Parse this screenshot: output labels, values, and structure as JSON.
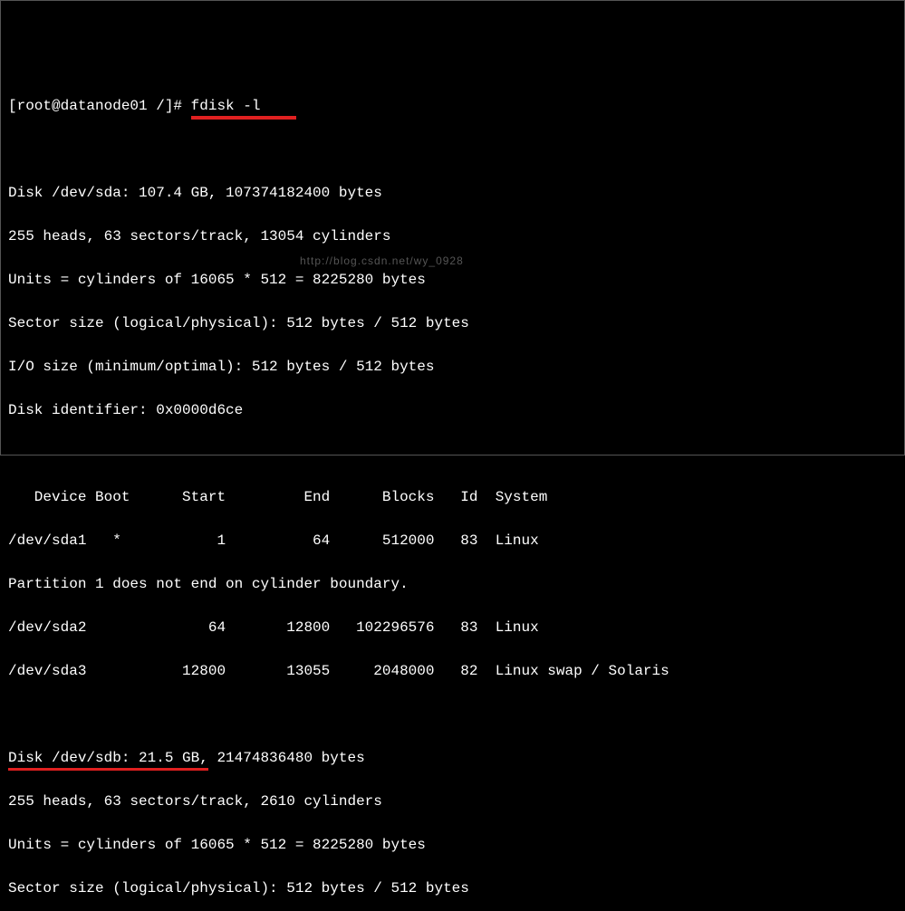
{
  "prompt": {
    "user_host_path": "[root@datanode01 /]# ",
    "command": "fdisk -l"
  },
  "sda": {
    "header": "Disk /dev/sda: 107.4 GB, 107374182400 bytes",
    "geometry": "255 heads, 63 sectors/track, 13054 cylinders",
    "units": "Units = cylinders of 16065 * 512 = 8225280 bytes",
    "sector": "Sector size (logical/physical): 512 bytes / 512 bytes",
    "io": "I/O size (minimum/optimal): 512 bytes / 512 bytes",
    "identifier": "Disk identifier: 0x0000d6ce"
  },
  "table": {
    "header": "   Device Boot      Start         End      Blocks   Id  System",
    "row1": "/dev/sda1   *           1          64      512000   83  Linux",
    "note": "Partition 1 does not end on cylinder boundary.",
    "row2": "/dev/sda2              64       12800   102296576   83  Linux",
    "row3": "/dev/sda3           12800       13055     2048000   82  Linux swap / Solaris"
  },
  "sdb": {
    "header_prefix": "Disk /dev/sdb: 21.5 GB,",
    "header_suffix": " 21474836480 bytes",
    "geometry": "255 heads, 63 sectors/track, 2610 cylinders",
    "units": "Units = cylinders of 16065 * 512 = 8225280 bytes",
    "sector": "Sector size (logical/physical): 512 bytes / 512 bytes"
  },
  "watermark": "http://blog.csdn.net/wy_0928"
}
